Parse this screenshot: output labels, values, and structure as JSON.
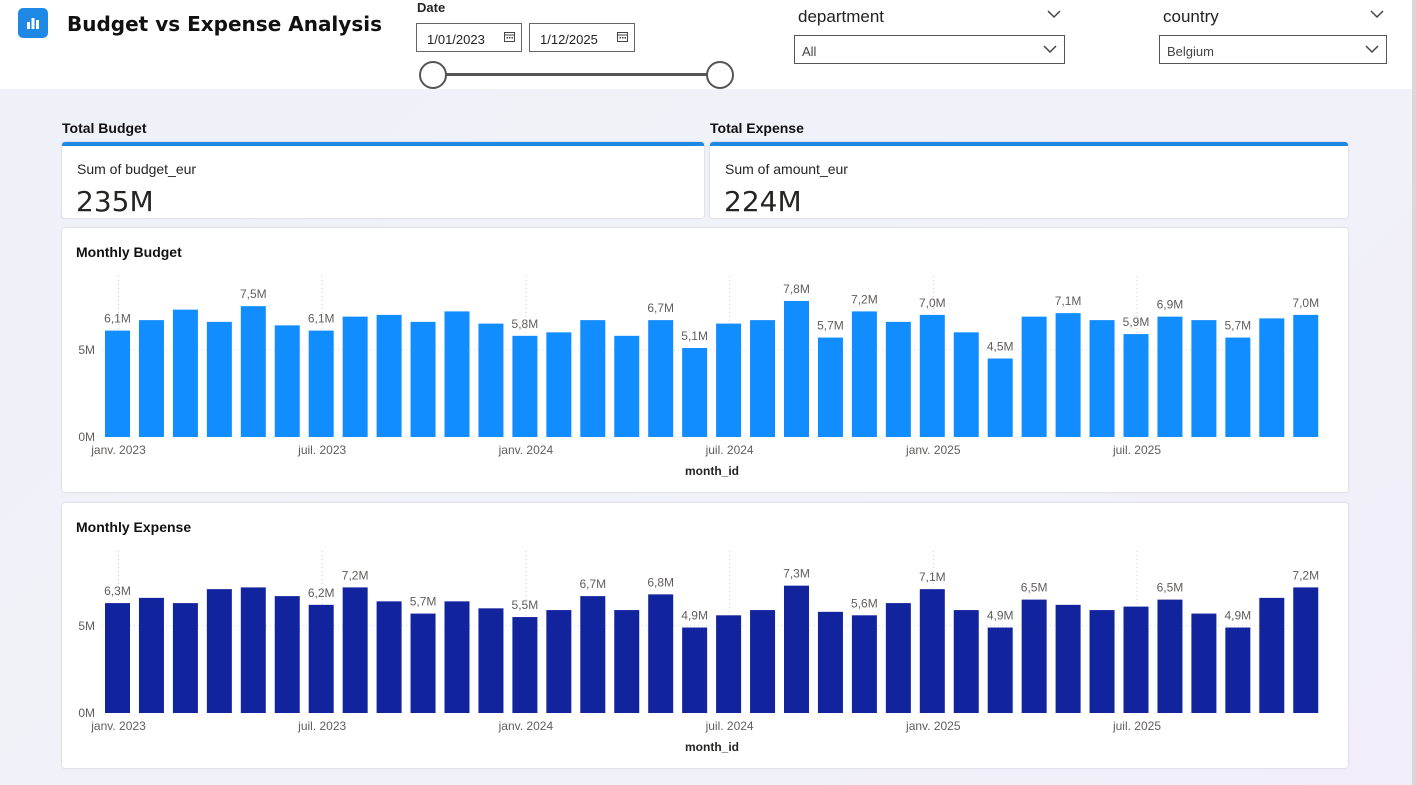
{
  "header": {
    "title": "Budget vs Expense Analysis",
    "app_icon": "bar-chart-icon"
  },
  "date_filter": {
    "label": "Date",
    "start": "1/01/2023",
    "end": "1/12/2025",
    "range_fraction": [
      0,
      1
    ]
  },
  "department_filter": {
    "label": "department",
    "value": "All"
  },
  "country_filter": {
    "label": "country",
    "value": "Belgium"
  },
  "kpis": {
    "budget": {
      "label": "Total Budget",
      "sub": "Sum of budget_eur",
      "value": "235M"
    },
    "expense": {
      "label": "Total Expense",
      "sub": "Sum of amount_eur",
      "value": "224M"
    }
  },
  "colors": {
    "accent": "#1e88e5",
    "budget_bar": "#118dff",
    "expense_bar": "#12239e"
  },
  "chart_data": [
    {
      "type": "bar",
      "title": "Monthly Budget",
      "xlabel": "month_id",
      "ylabel": "",
      "ylim": [
        0,
        9
      ],
      "yticks": [
        "0M",
        "5M"
      ],
      "xticks": [
        {
          "index": 0,
          "label": "janv. 2023"
        },
        {
          "index": 6,
          "label": "juil. 2023"
        },
        {
          "index": 12,
          "label": "janv. 2024"
        },
        {
          "index": 18,
          "label": "juil. 2024"
        },
        {
          "index": 24,
          "label": "janv. 2025"
        },
        {
          "index": 30,
          "label": "juil. 2025"
        }
      ],
      "values": [
        6.1,
        6.7,
        7.3,
        6.6,
        7.5,
        6.4,
        6.1,
        6.9,
        7.0,
        6.6,
        7.2,
        6.5,
        5.8,
        6.0,
        6.7,
        5.8,
        6.7,
        5.1,
        6.5,
        6.7,
        7.8,
        5.7,
        7.2,
        6.6,
        7.0,
        6.0,
        4.5,
        6.9,
        7.1,
        6.7,
        5.9,
        6.9,
        6.7,
        5.7,
        6.8,
        7.0
      ],
      "data_labels": [
        {
          "index": 0,
          "label": "6,1M"
        },
        {
          "index": 4,
          "label": "7,5M"
        },
        {
          "index": 6,
          "label": "6,1M"
        },
        {
          "index": 12,
          "label": "5,8M"
        },
        {
          "index": 16,
          "label": "6,7M"
        },
        {
          "index": 17,
          "label": "5,1M"
        },
        {
          "index": 20,
          "label": "7,8M"
        },
        {
          "index": 21,
          "label": "5,7M"
        },
        {
          "index": 22,
          "label": "7,2M"
        },
        {
          "index": 24,
          "label": "7,0M"
        },
        {
          "index": 26,
          "label": "4,5M"
        },
        {
          "index": 28,
          "label": "7,1M"
        },
        {
          "index": 30,
          "label": "5,9M"
        },
        {
          "index": 31,
          "label": "6,9M"
        },
        {
          "index": 33,
          "label": "5,7M"
        },
        {
          "index": 35,
          "label": "7,0M"
        }
      ]
    },
    {
      "type": "bar",
      "title": "Monthly Expense",
      "xlabel": "month_id",
      "ylabel": "",
      "ylim": [
        0,
        9
      ],
      "yticks": [
        "0M",
        "5M"
      ],
      "xticks": [
        {
          "index": 0,
          "label": "janv. 2023"
        },
        {
          "index": 6,
          "label": "juil. 2023"
        },
        {
          "index": 12,
          "label": "janv. 2024"
        },
        {
          "index": 18,
          "label": "juil. 2024"
        },
        {
          "index": 24,
          "label": "janv. 2025"
        },
        {
          "index": 30,
          "label": "juil. 2025"
        }
      ],
      "values": [
        6.3,
        6.6,
        6.3,
        7.1,
        7.2,
        6.7,
        6.2,
        7.2,
        6.4,
        5.7,
        6.4,
        6.0,
        5.5,
        5.9,
        6.7,
        5.9,
        6.8,
        4.9,
        5.6,
        5.9,
        7.3,
        5.8,
        5.6,
        6.3,
        7.1,
        5.9,
        4.9,
        6.5,
        6.2,
        5.9,
        6.1,
        6.5,
        5.7,
        4.9,
        6.6,
        7.2
      ],
      "data_labels": [
        {
          "index": 0,
          "label": "6,3M"
        },
        {
          "index": 6,
          "label": "6,2M"
        },
        {
          "index": 7,
          "label": "7,2M"
        },
        {
          "index": 9,
          "label": "5,7M"
        },
        {
          "index": 12,
          "label": "5,5M"
        },
        {
          "index": 14,
          "label": "6,7M"
        },
        {
          "index": 16,
          "label": "6,8M"
        },
        {
          "index": 17,
          "label": "4,9M"
        },
        {
          "index": 20,
          "label": "7,3M"
        },
        {
          "index": 22,
          "label": "5,6M"
        },
        {
          "index": 24,
          "label": "7,1M"
        },
        {
          "index": 26,
          "label": "4,9M"
        },
        {
          "index": 27,
          "label": "6,5M"
        },
        {
          "index": 31,
          "label": "6,5M"
        },
        {
          "index": 33,
          "label": "4,9M"
        },
        {
          "index": 35,
          "label": "7,2M"
        }
      ]
    }
  ]
}
